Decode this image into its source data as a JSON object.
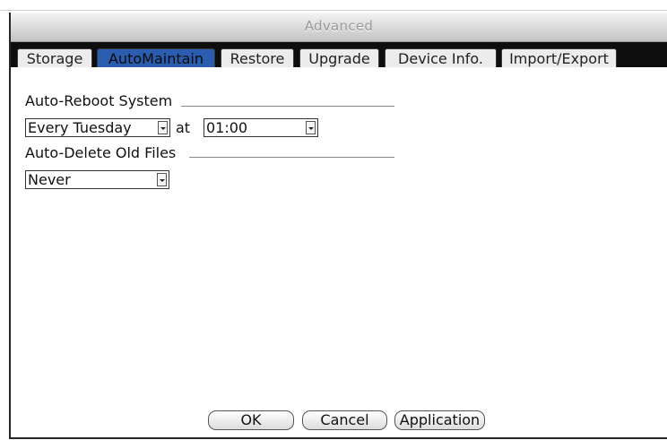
{
  "window": {
    "title": "Advanced"
  },
  "tabs": [
    {
      "label": "Storage",
      "active": false
    },
    {
      "label": "AutoMaintain",
      "active": true
    },
    {
      "label": "Restore",
      "active": false
    },
    {
      "label": "Upgrade",
      "active": false
    },
    {
      "label": "Device Info.",
      "active": false
    },
    {
      "label": "Import/Export",
      "active": false
    }
  ],
  "auto_reboot": {
    "label": "Auto-Reboot System",
    "day_value": "Every Tuesday",
    "at_label": "at",
    "time_value": "01:00"
  },
  "auto_delete": {
    "label": "Auto-Delete Old Files",
    "value": "Never"
  },
  "buttons": {
    "ok": "OK",
    "cancel": "Cancel",
    "apply": "Application"
  },
  "colors": {
    "active_tab": "#2a5cb0",
    "tab_strip": "#0e0e0e",
    "title_text": "#9a9a9a"
  }
}
